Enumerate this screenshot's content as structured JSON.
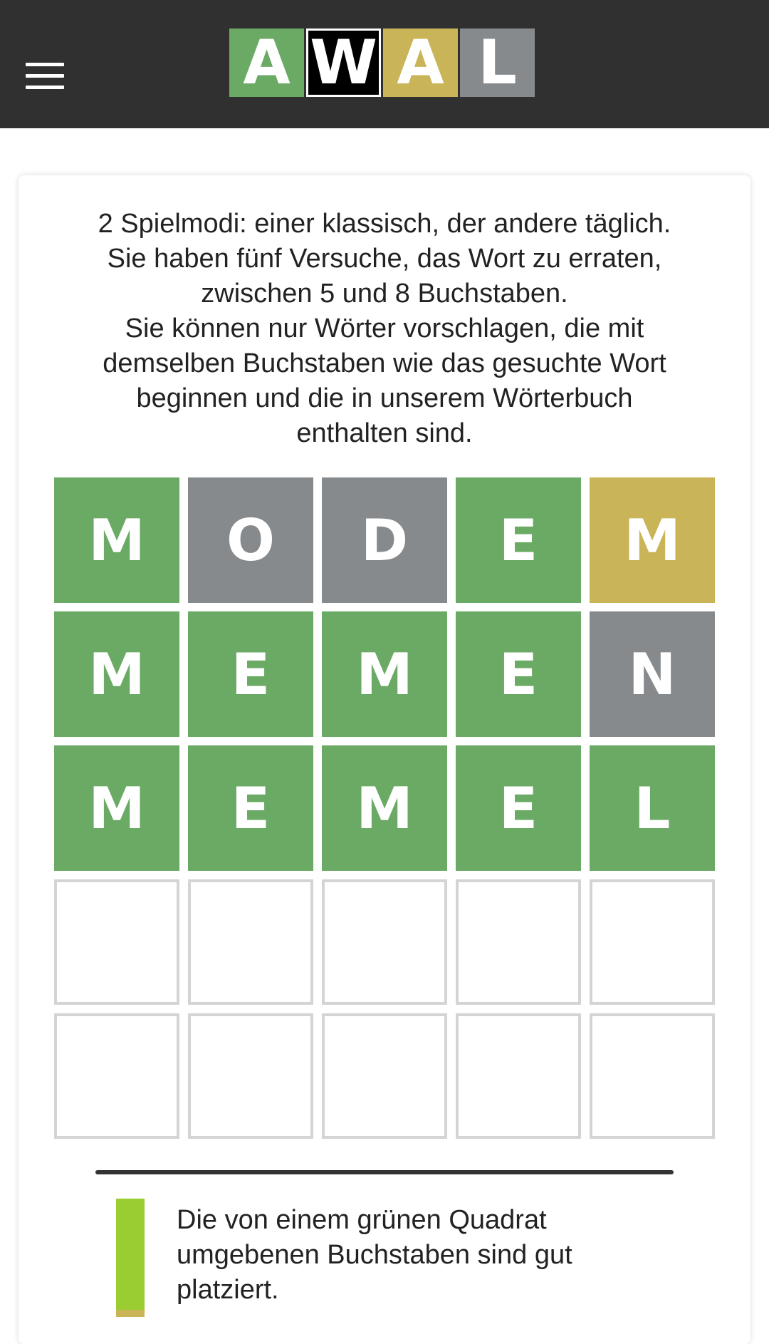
{
  "header": {
    "menu_icon": "hamburger-menu-icon",
    "background": "#303030",
    "logo": [
      {
        "letter": "A",
        "color": "#6aaa64"
      },
      {
        "letter": "W",
        "color": "#000000"
      },
      {
        "letter": "A",
        "color": "#c9b458"
      },
      {
        "letter": "L",
        "color": "#878a8c"
      }
    ]
  },
  "intro_lines": [
    "2 Spielmodi: einer klassisch, der andere täglich.",
    "Sie haben fünf Versuche, das Wort zu erraten,",
    "zwischen 5 und 8 Buchstaben.",
    "Sie können nur Wörter vorschlagen, die mit",
    "demselben Buchstaben wie das gesuchte Wort",
    "beginnen und die in unserem Wörterbuch",
    "enthalten sind."
  ],
  "colors": {
    "correct": "#6aaa64",
    "present": "#c9b458",
    "absent": "#878a8c",
    "legend_green": "#9acd32"
  },
  "board": [
    [
      {
        "letter": "M",
        "state": "correct"
      },
      {
        "letter": "O",
        "state": "absent"
      },
      {
        "letter": "D",
        "state": "absent"
      },
      {
        "letter": "E",
        "state": "correct"
      },
      {
        "letter": "M",
        "state": "present"
      }
    ],
    [
      {
        "letter": "M",
        "state": "correct"
      },
      {
        "letter": "E",
        "state": "correct"
      },
      {
        "letter": "M",
        "state": "correct"
      },
      {
        "letter": "E",
        "state": "correct"
      },
      {
        "letter": "N",
        "state": "absent"
      }
    ],
    [
      {
        "letter": "M",
        "state": "correct"
      },
      {
        "letter": "E",
        "state": "correct"
      },
      {
        "letter": "M",
        "state": "correct"
      },
      {
        "letter": "E",
        "state": "correct"
      },
      {
        "letter": "L",
        "state": "correct"
      }
    ],
    [
      {
        "letter": "",
        "state": "empty"
      },
      {
        "letter": "",
        "state": "empty"
      },
      {
        "letter": "",
        "state": "empty"
      },
      {
        "letter": "",
        "state": "empty"
      },
      {
        "letter": "",
        "state": "empty"
      }
    ],
    [
      {
        "letter": "",
        "state": "empty"
      },
      {
        "letter": "",
        "state": "empty"
      },
      {
        "letter": "",
        "state": "empty"
      },
      {
        "letter": "",
        "state": "empty"
      },
      {
        "letter": "",
        "state": "empty"
      }
    ]
  ],
  "legend": {
    "green_lines": [
      "Die von einem grünen Quadrat",
      "umgebenen Buchstaben sind gut",
      "platziert."
    ]
  }
}
